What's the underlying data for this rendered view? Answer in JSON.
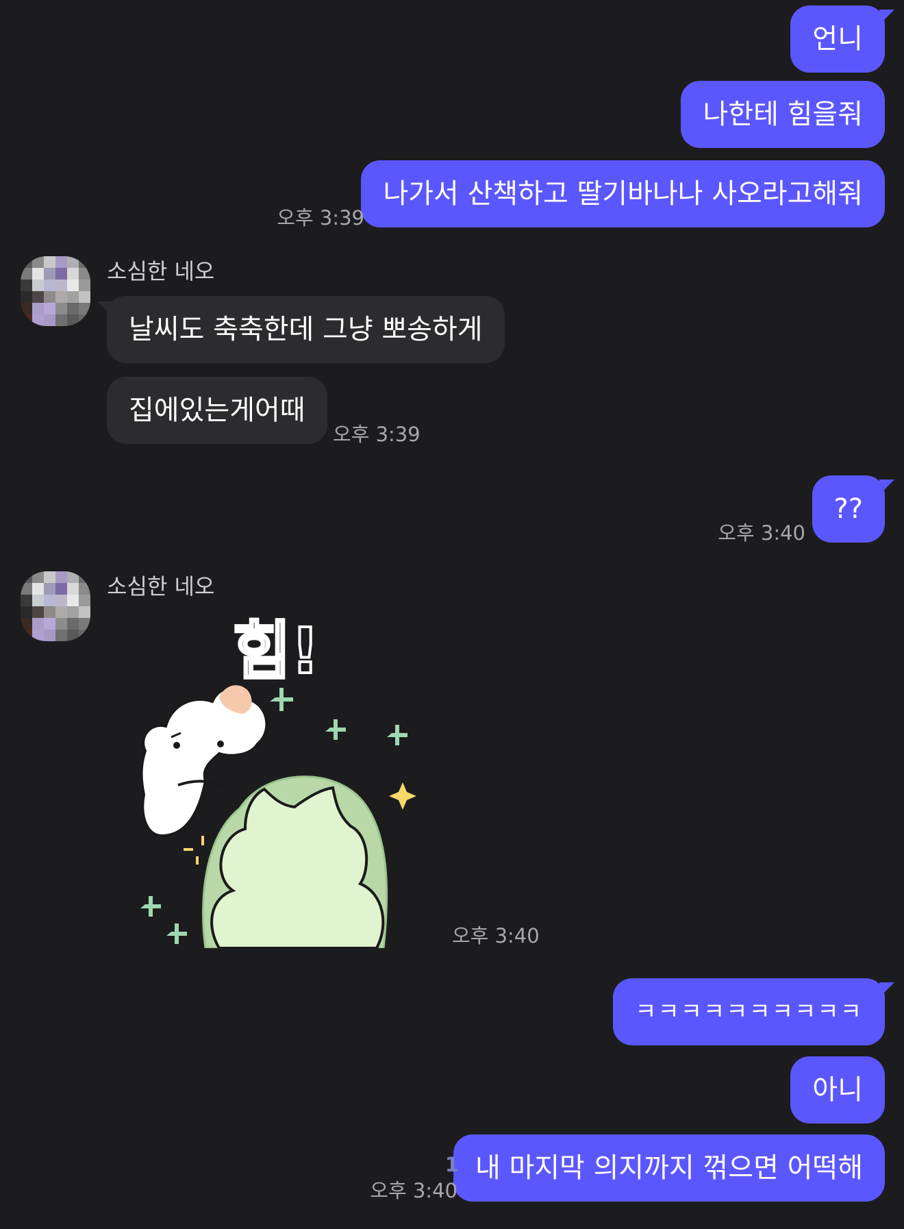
{
  "colors": {
    "background": "#1c1c1e",
    "outgoing_bubble": "#5b57ff",
    "incoming_bubble": "#2c2c2e",
    "timestamp": "#a7a7ac",
    "unread_count": "#7b7ec0"
  },
  "messages": {
    "out1": {
      "text": "언니"
    },
    "out2": {
      "text": "나한테 힘을줘"
    },
    "out3": {
      "text": "나가서 산책하고 딸기바나나 사오라고해줘",
      "time": "오후 3:39"
    },
    "in_group1": {
      "sender": "소심한 네오",
      "msg1": "날씨도 축축한데 그냥 뽀송하게",
      "msg2": "집에있는게어때",
      "time": "오후 3:39"
    },
    "out4": {
      "text": "??",
      "time": "오후 3:40"
    },
    "in_group2": {
      "sender": "소심한 네오",
      "sticker_text": "힘!",
      "sticker_icon": "cat-sticker-icon",
      "time": "오후 3:40"
    },
    "out5": {
      "text": "ㅋㅋㅋㅋㅋㅋㅋㅋㅋㅋ"
    },
    "out6": {
      "text": "아니"
    },
    "out7": {
      "text": "내 마지막 의지까지 꺾으면 어떡해",
      "time": "오후 3:40",
      "unread": "1"
    }
  }
}
